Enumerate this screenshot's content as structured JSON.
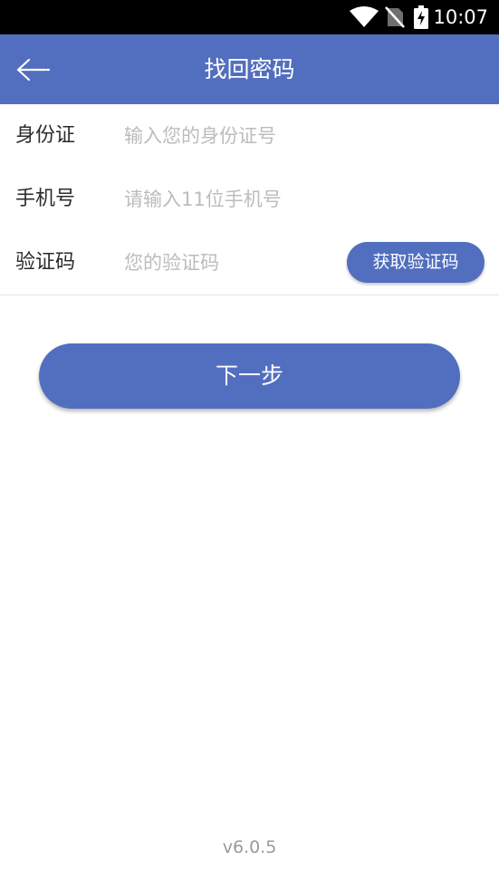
{
  "status_bar": {
    "time": "10:07",
    "icons": [
      "wifi-icon",
      "no-sim-icon",
      "battery-charging-icon"
    ]
  },
  "app_bar": {
    "title": "找回密码",
    "back_icon": "arrow-left-icon",
    "background_color": "#526fbf"
  },
  "form": {
    "id_card": {
      "label": "身份证",
      "value": "",
      "placeholder": "输入您的身份证号"
    },
    "phone": {
      "label": "手机号",
      "value": "",
      "placeholder": "请输入11位手机号"
    },
    "code": {
      "label": "验证码",
      "value": "",
      "placeholder": "您的验证码",
      "button_label": "获取验证码"
    }
  },
  "next_button": {
    "label": "下一步"
  },
  "footer": {
    "version": "v6.0.5"
  },
  "colors": {
    "accent": "#526fbf",
    "placeholder": "#bcbcbc",
    "divider": "#e3e3e3"
  }
}
